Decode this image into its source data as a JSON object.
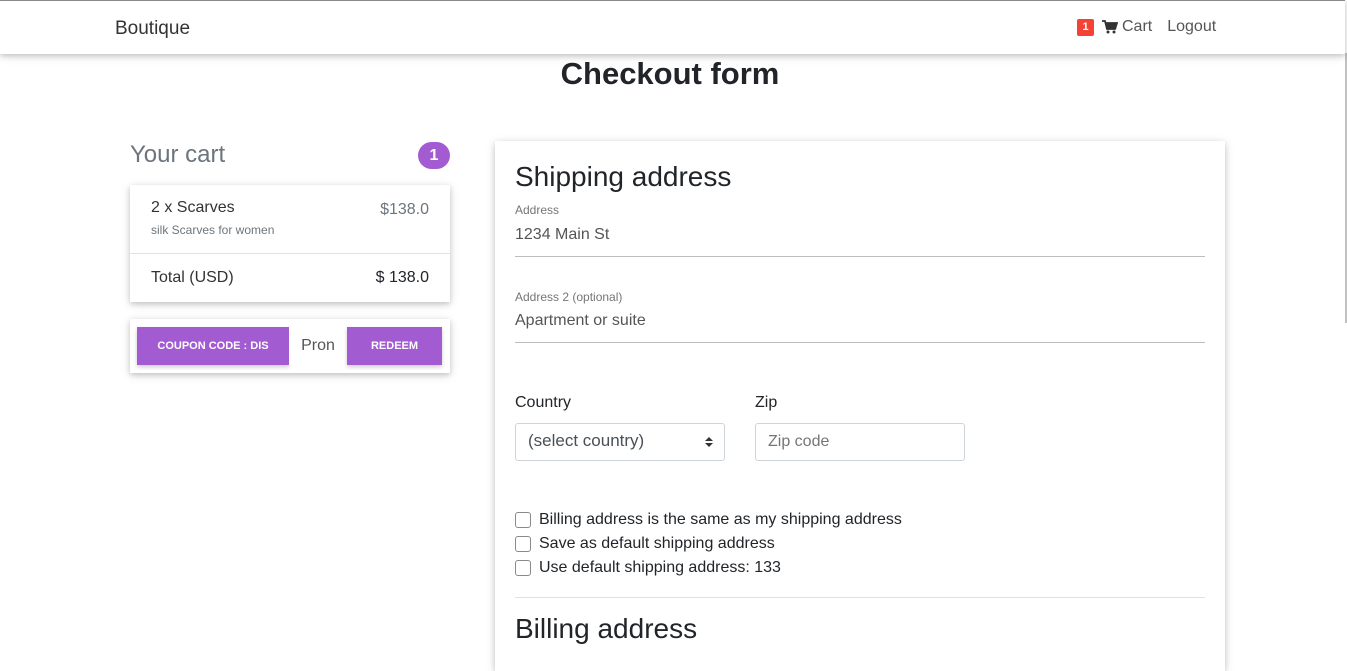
{
  "navbar": {
    "brand": "Boutique",
    "cart_count": "1",
    "cart_label": "Cart",
    "logout_label": "Logout"
  },
  "page": {
    "title": "Checkout form"
  },
  "cart": {
    "heading": "Your cart",
    "badge": "1",
    "items": [
      {
        "name": "2 x Scarves",
        "description": "silk Scarves for women",
        "price": "$138.0"
      }
    ],
    "total_label": "Total (USD)",
    "total_value": "$ 138.0"
  },
  "coupon": {
    "button_label": "COUPON CODE : DIS",
    "input_value": "Pron",
    "redeem_label": "REDEEM"
  },
  "shipping": {
    "heading": "Shipping address",
    "address_label": "Address",
    "address_value": "1234 Main St",
    "address2_label": "Address 2 (optional)",
    "address2_value": "Apartment or suite",
    "country_label": "Country",
    "country_selected": "(select country)",
    "zip_label": "Zip",
    "zip_placeholder": "Zip code",
    "checkboxes": [
      "Billing address is the same as my shipping address",
      "Save as default shipping address",
      "Use default shipping address: 133"
    ]
  },
  "billing": {
    "heading": "Billing address"
  },
  "colors": {
    "accent": "#a35bd1",
    "cart_badge": "#f44336"
  },
  "icons": [
    "shopping-cart-icon",
    "select-arrows-icon"
  ]
}
